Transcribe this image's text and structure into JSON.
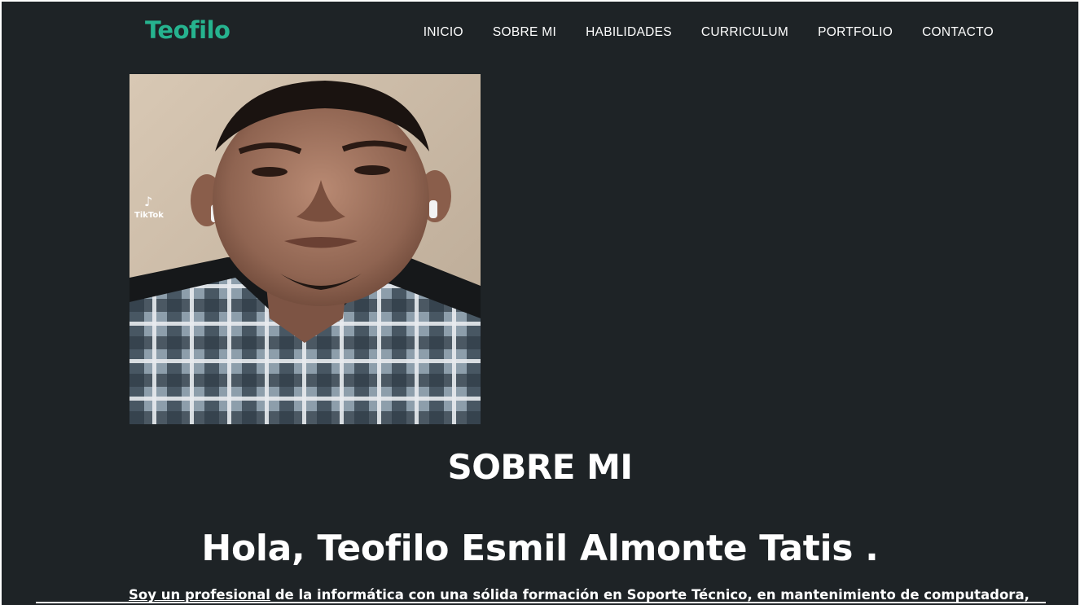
{
  "brand": {
    "logo_text": "Teofilo",
    "accent_color": "#26b38f",
    "background_color": "#1e2326"
  },
  "nav": {
    "items": [
      {
        "label": "INICIO"
      },
      {
        "label": "SOBRE MI"
      },
      {
        "label": "HABILIDADES"
      },
      {
        "label": "CURRICULUM"
      },
      {
        "label": "PORTFOLIO"
      },
      {
        "label": "CONTACTO"
      }
    ]
  },
  "profile_photo": {
    "watermark_text": "TikTok"
  },
  "about": {
    "title": "SOBRE MI",
    "greeting": "Hola, Teofilo Esmil Almonte Tatis .",
    "bio_underlined": "Soy un profesional",
    "bio_rest": " de la informática con una sólida formación en Soporte Técnico, en mantenimiento de computadora,"
  }
}
